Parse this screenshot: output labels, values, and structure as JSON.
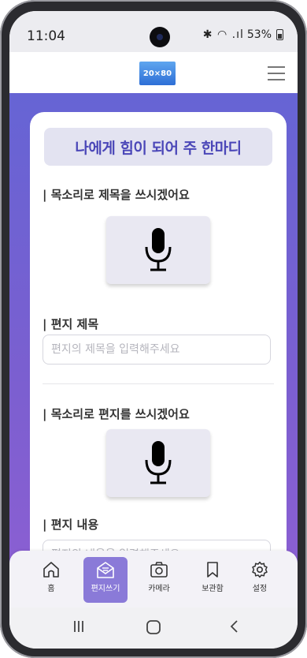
{
  "status_bar": {
    "time": "11:04",
    "indicators": "✱ ◠ .ıl",
    "battery": "53%"
  },
  "header": {
    "logo_text": "20×80"
  },
  "card": {
    "title": "나에게 힘이 되어 주 한마디",
    "voice_title_label": "| 목소리로 제목을 쓰시겠어요",
    "title_label": "| 편지 제목",
    "title_input": {
      "value": "",
      "placeholder": "편지의 제목을 입력해주세요"
    },
    "voice_letter_label": "| 목소리로 편지를 쓰시겠어요",
    "content_label": "| 편지 내용",
    "content_input": {
      "value": "",
      "placeholder": "편지의 내용을 입력해주세요"
    }
  },
  "bottom_nav": {
    "items": [
      {
        "label": "홈",
        "icon": "home-icon"
      },
      {
        "label": "편지쓰기",
        "icon": "letter-icon",
        "active": true
      },
      {
        "label": "카메라",
        "icon": "camera-icon"
      },
      {
        "label": "보관함",
        "icon": "bookmark-icon"
      },
      {
        "label": "설정",
        "icon": "gear-icon"
      }
    ]
  },
  "colors": {
    "accent": "#4b47b8",
    "gradient_top": "#6664d4",
    "gradient_bottom": "#8a5fd2",
    "active_nav": "#8a7ad8"
  }
}
